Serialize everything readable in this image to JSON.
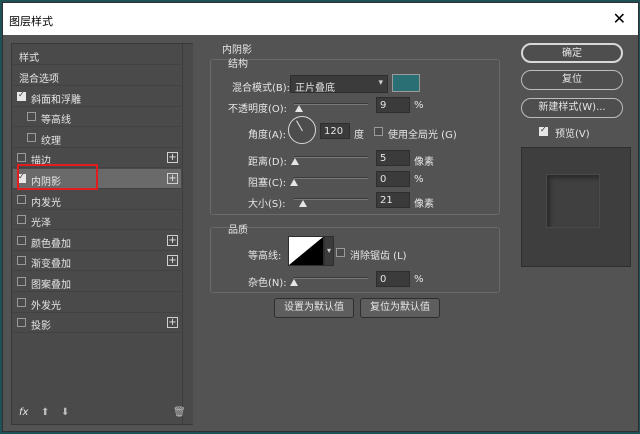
{
  "window": {
    "title": "图层样式",
    "close_glyph": "✕"
  },
  "styles_panel": {
    "header": "样式",
    "items": [
      {
        "label": "混合选项",
        "checkbox": false,
        "checked": false,
        "plus": false,
        "indent": false
      },
      {
        "label": "斜面和浮雕",
        "checkbox": true,
        "checked": true,
        "plus": false,
        "indent": false
      },
      {
        "label": "等高线",
        "checkbox": true,
        "checked": false,
        "plus": false,
        "indent": true
      },
      {
        "label": "纹理",
        "checkbox": true,
        "checked": false,
        "plus": false,
        "indent": true
      },
      {
        "label": "描边",
        "checkbox": true,
        "checked": false,
        "plus": true,
        "indent": false
      },
      {
        "label": "内阴影",
        "checkbox": true,
        "checked": true,
        "plus": true,
        "indent": false,
        "selected": true
      },
      {
        "label": "内发光",
        "checkbox": true,
        "checked": false,
        "plus": false,
        "indent": false
      },
      {
        "label": "光泽",
        "checkbox": true,
        "checked": false,
        "plus": false,
        "indent": false
      },
      {
        "label": "颜色叠加",
        "checkbox": true,
        "checked": false,
        "plus": true,
        "indent": false
      },
      {
        "label": "渐变叠加",
        "checkbox": true,
        "checked": false,
        "plus": true,
        "indent": false
      },
      {
        "label": "图案叠加",
        "checkbox": true,
        "checked": false,
        "plus": false,
        "indent": false
      },
      {
        "label": "外发光",
        "checkbox": true,
        "checked": false,
        "plus": false,
        "indent": false
      },
      {
        "label": "投影",
        "checkbox": true,
        "checked": false,
        "plus": true,
        "indent": false
      }
    ],
    "bottom_icons": {
      "fx": "fx",
      "up": "⬆",
      "down": "⬇",
      "trash": "🗑"
    }
  },
  "inner_shadow": {
    "title": "内阴影",
    "structure": {
      "title": "结构",
      "blend_mode_label": "混合模式(B):",
      "blend_mode_value": "正片叠底",
      "color": "#2a6f74",
      "opacity_label": "不透明度(O):",
      "opacity_value": "9",
      "opacity_unit": "%",
      "angle_label": "角度(A):",
      "angle_value": "120",
      "angle_unit": "度",
      "global_light_label": "使用全局光 (G)",
      "distance_label": "距离(D):",
      "distance_value": "5",
      "distance_unit": "像素",
      "choke_label": "阻塞(C):",
      "choke_value": "0",
      "choke_unit": "%",
      "size_label": "大小(S):",
      "size_value": "21",
      "size_unit": "像素"
    },
    "quality": {
      "title": "品质",
      "contour_label": "等高线:",
      "antialias_label": "消除锯齿 (L)",
      "noise_label": "杂色(N):",
      "noise_value": "0",
      "noise_unit": "%"
    },
    "make_default_label": "设置为默认值",
    "reset_default_label": "复位为默认值"
  },
  "right_panel": {
    "ok_label": "确定",
    "reset_label": "复位",
    "new_style_label": "新建样式(W)...",
    "preview_label": "预览(V)",
    "preview_checked": true
  }
}
